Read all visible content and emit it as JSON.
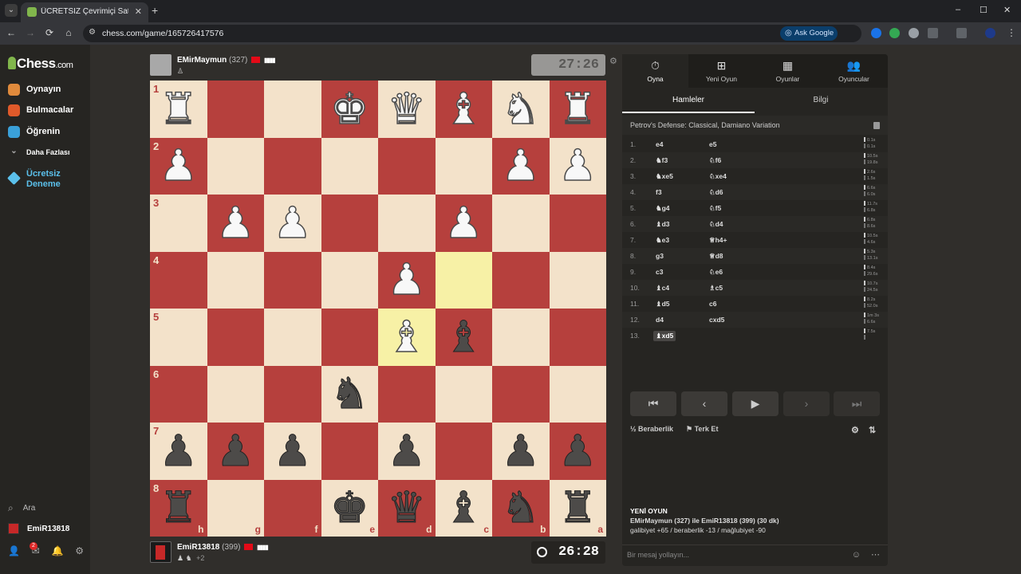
{
  "browser": {
    "tab_switch": "⌄",
    "tab_title": "ÜCRETSİZ Çevrimiçi Satranç Oyna",
    "tab_close": "✕",
    "new_tab": "+",
    "url": "chess.com/game/165726417576",
    "ask_google": "Ask Google",
    "back": "←",
    "forward": "→",
    "reload": "⟳",
    "home": "⌂",
    "min": "–",
    "max": "☐",
    "close": "✕"
  },
  "sidebar": {
    "logo": "Chess",
    "logo_suffix": ".com",
    "items": [
      {
        "label": "Oynayın",
        "icon": "play-icon",
        "color": "#e08a3c"
      },
      {
        "label": "Bulmacalar",
        "icon": "puzzle-icon",
        "color": "#e05a2a"
      },
      {
        "label": "Öğrenin",
        "icon": "learn-icon",
        "color": "#3aa0d8"
      },
      {
        "label": "Daha Fazlası",
        "icon": "chevron-down-icon",
        "color": "#888888"
      },
      {
        "label": "Ücretsiz Deneme",
        "icon": "diamond-icon",
        "color": "#5bc0eb"
      }
    ],
    "search_label": "Ara",
    "username": "EmiR13818",
    "notification_count": "2"
  },
  "top_player": {
    "name": "EMirMaymun",
    "rating": "(327)",
    "clock": "27:26",
    "captured": "♙",
    "bars": "▮▮▮▮"
  },
  "bottom_player": {
    "name": "EmiR13818",
    "rating": "(399)",
    "clock": "26:28",
    "captured": "♟ ♞",
    "advantage": "+2",
    "bars": "▮▮▮▮"
  },
  "board": {
    "orientation": "black",
    "ranks": [
      "1",
      "2",
      "3",
      "4",
      "5",
      "6",
      "7",
      "8"
    ],
    "files": [
      "h",
      "g",
      "f",
      "e",
      "d",
      "c",
      "b",
      "a"
    ],
    "highlight_squares": [
      "c4",
      "d5"
    ],
    "rows": [
      [
        "wR",
        "",
        "",
        "wK",
        "wQ",
        "wB",
        "wN",
        "wR"
      ],
      [
        "wP",
        "",
        "",
        "",
        "",
        "",
        "wP",
        "wP"
      ],
      [
        "",
        "wP",
        "wP",
        "",
        "",
        "wP",
        "",
        ""
      ],
      [
        "",
        "",
        "",
        "",
        "wP",
        "",
        "",
        ""
      ],
      [
        "",
        "",
        "",
        "",
        "wB",
        "bB",
        "",
        ""
      ],
      [
        "",
        "",
        "",
        "bN",
        "",
        "",
        "",
        ""
      ],
      [
        "bP",
        "bP",
        "bP",
        "",
        "bP",
        "",
        "bP",
        "bP"
      ],
      [
        "bR",
        "",
        "",
        "bK",
        "bQ",
        "bB",
        "bN",
        "bR"
      ]
    ]
  },
  "panel": {
    "tabs": [
      {
        "label": "Oyna",
        "icon": "⏱"
      },
      {
        "label": "Yeni Oyun",
        "icon": "⊞"
      },
      {
        "label": "Oyunlar",
        "icon": "▦"
      },
      {
        "label": "Oyuncular",
        "icon": "👥"
      }
    ],
    "subtabs": [
      "Hamleler",
      "Bilgi"
    ],
    "opening": "Petrov's Defense: Classical, Damiano Variation",
    "moves": [
      {
        "n": "1.",
        "w": "e4",
        "b": "e5",
        "tw": "0.1s",
        "tb": "0.1s"
      },
      {
        "n": "2.",
        "w": "♞f3",
        "b": "♘f6",
        "tw": "10.5s",
        "tb": "19.8s"
      },
      {
        "n": "3.",
        "w": "♞xe5",
        "b": "♘xe4",
        "tw": "2.6s",
        "tb": "1.5s"
      },
      {
        "n": "4.",
        "w": "f3",
        "b": "♘d6",
        "tw": "6.6s",
        "tb": "6.0s"
      },
      {
        "n": "5.",
        "w": "♞g4",
        "b": "♘f5",
        "tw": "11.7s",
        "tb": "6.8s"
      },
      {
        "n": "6.",
        "w": "♝d3",
        "b": "♘d4",
        "tw": "6.8s",
        "tb": "8.6s"
      },
      {
        "n": "7.",
        "w": "♞e3",
        "b": "♕h4+",
        "tw": "10.5s",
        "tb": "4.6s"
      },
      {
        "n": "8.",
        "w": "g3",
        "b": "♕d8",
        "tw": "5.3s",
        "tb": "13.1s"
      },
      {
        "n": "9.",
        "w": "c3",
        "b": "♘e6",
        "tw": "8.4s",
        "tb": "29.6s"
      },
      {
        "n": "10.",
        "w": "♝c4",
        "b": "♗c5",
        "tw": "10.7s",
        "tb": "24.5s"
      },
      {
        "n": "11.",
        "w": "♝d5",
        "b": "c6",
        "tw": "8.2s",
        "tb": "52.0s"
      },
      {
        "n": "12.",
        "w": "d4",
        "b": "cxd5",
        "tw": "1m 3s",
        "tb": "6.6s"
      },
      {
        "n": "13.",
        "w": "♝xd5",
        "b": "",
        "tw": "7.5s",
        "tb": ""
      }
    ],
    "controls": [
      "⏮",
      "‹",
      "▶",
      "›",
      "⏭"
    ],
    "draw_label": "Beraberlik",
    "resign_label": "Terk Et",
    "draw_icon": "½",
    "resign_icon": "⚑",
    "newgame_title": "YENİ OYUN",
    "newgame_line1": "EMirMaymun (327) ile EmiR13818 (399) (30 dk)",
    "newgame_line2": "galibiyet +65 / beraberlik -13 / mağlubiyet -90",
    "chat_placeholder": "Bir mesaj yollayın..."
  }
}
